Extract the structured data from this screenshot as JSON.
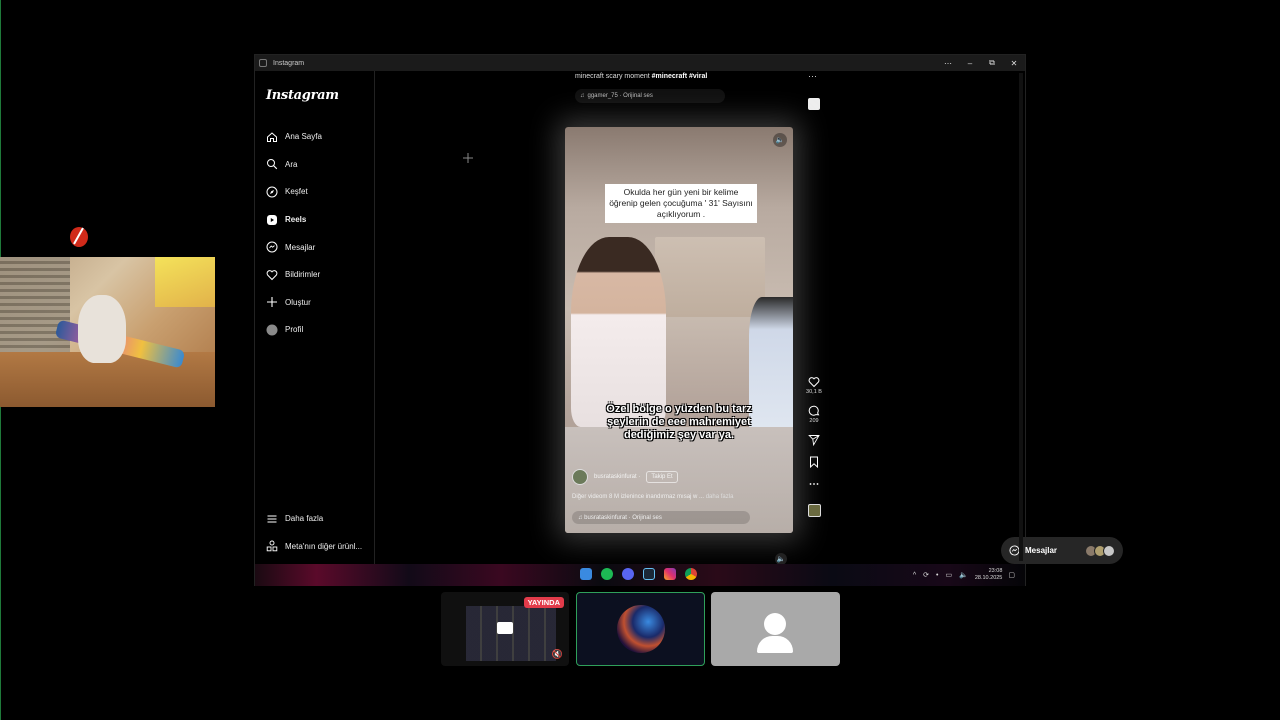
{
  "window": {
    "title": "Instagram",
    "controls": [
      "⋯",
      "–",
      "⧉",
      "✕"
    ]
  },
  "sidebar": {
    "logo": "Instagram",
    "items": [
      {
        "label": "Ana Sayfa",
        "icon": "home-icon"
      },
      {
        "label": "Ara",
        "icon": "search-icon"
      },
      {
        "label": "Keşfet",
        "icon": "compass-icon"
      },
      {
        "label": "Reels",
        "icon": "reels-icon",
        "active": true
      },
      {
        "label": "Mesajlar",
        "icon": "messenger-icon"
      },
      {
        "label": "Bildirimler",
        "icon": "heart-icon"
      },
      {
        "label": "Oluştur",
        "icon": "plus-icon"
      },
      {
        "label": "Profil",
        "icon": "avatar-icon"
      }
    ],
    "bottom": [
      {
        "label": "Daha fazla",
        "icon": "menu-icon"
      },
      {
        "label": "Meta'nın diğer ürünl...",
        "icon": "meta-apps-icon"
      }
    ]
  },
  "prev_reel": {
    "caption_text": "minecraft scary moment ",
    "caption_tags": "#minecraft #viral",
    "audio": "ggamer_75 · Orijinal ses"
  },
  "reel": {
    "overlay_top": "Okulda her gün yeni bir kelime öğrenip gelen çocuğuma ' 31' Sayısını açıklıyorum .",
    "subtitle": "Özel bölge o yüzden bu tarz şeylerin de eee mahremiyet dediğimiz şey var ya.",
    "author": "busrataskinfurat",
    "follow_label": "Takip Et",
    "description": "Diğer videom 8 M izlenince inandırmaz mısaj w ...",
    "more_label": "daha fazla",
    "audio": "busrataskinfurat · Orijinal ses",
    "likes": "30,1 B",
    "comments": "209"
  },
  "messages_pill": {
    "label": "Mesajlar"
  },
  "taskbar": {
    "time": "23:08",
    "date": "28.10.2025"
  },
  "call": {
    "live_badge": "YAYINDA"
  },
  "colors": {
    "accent_green": "#2fa05a",
    "live_red": "#e23b4a",
    "background": "#000000"
  }
}
